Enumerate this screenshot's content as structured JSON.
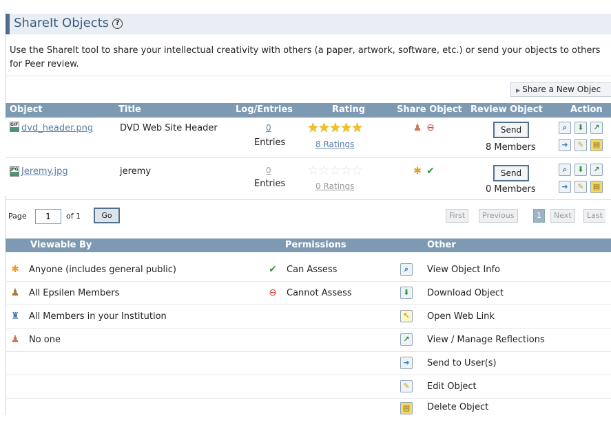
{
  "page": {
    "title": "ShareIt Objects",
    "intro": "Use the ShareIt tool to share your intellectual creativity with others (a paper, artwork, software, etc.) or send your objects to others for Peer review.",
    "share_new": "Share a New Objec"
  },
  "table": {
    "headers": [
      "Object",
      "Title",
      "Log/Entries",
      "Rating",
      "Share Object",
      "Review Object",
      "Action"
    ],
    "rows": [
      {
        "file": "dvd_header.png",
        "file_type": "GIF",
        "title": "DVD Web Site Header",
        "log_count": "0",
        "log_label": "Entries",
        "stars": 5,
        "ratings": "8 Ratings",
        "send": "Send",
        "members": "8 Members"
      },
      {
        "file": "Jeremy.jpg",
        "file_type": "JPG",
        "title": "jeremy",
        "log_count": "0",
        "log_label": "Entries",
        "stars": 0,
        "ratings": "0 Ratings",
        "send": "Send",
        "members": "0 Members"
      }
    ]
  },
  "pager": {
    "page_label": "Page",
    "page_value": "1",
    "of_label": "of 1",
    "go": "Go",
    "first": "First",
    "previous": "Previous",
    "current": "1",
    "next": "Next",
    "last": "Last"
  },
  "legend": {
    "headers": [
      "Viewable By",
      "Permissions",
      "Other"
    ],
    "viewable": [
      "Anyone (includes general public)",
      "All Epsilen Members",
      "All Members in your Institution",
      "No one"
    ],
    "permissions": [
      "Can Assess",
      "Cannot Assess"
    ],
    "other": [
      "View Object Info",
      "Download Object",
      "Open Web Link",
      "View / Manage Reflections",
      "Send to User(s)",
      "Edit Object",
      "Delete Object"
    ]
  },
  "icons": {
    "anyone": "asterisk-icon",
    "members": "people-icon",
    "institution": "building-people-icon",
    "noone": "blocked-person-icon",
    "can": "check-icon",
    "cannot": "stop-icon"
  },
  "colors": {
    "header_bg": "#7e9ab3",
    "link": "#5a7fa6",
    "star": "#f1c21b"
  }
}
